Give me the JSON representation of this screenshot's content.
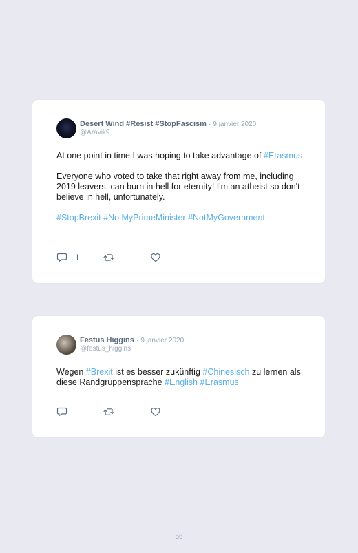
{
  "tweets": [
    {
      "author": "Desert Wind #Resist #StopFascism",
      "date": "9 janvier 2020",
      "handle": "@Aravik9",
      "p1": [
        "At one point in time I was hoping to take advantage of ",
        "#Erasmus"
      ],
      "p2": "Everyone who voted to take that right away from me, including 2019 leavers, can burn in hell for eternity! I'm an atheist so don't believe in hell, unfortunately.",
      "p3": [
        "#StopBrexit",
        "#NotMyPrimeMinister",
        "#NotMyGovernment"
      ],
      "reply_count": "1"
    },
    {
      "author": "Festus Higgins",
      "date": "9 janvier 2020",
      "handle": "@festus_higgins",
      "p1": [
        "Wegen ",
        "#Brexit",
        " ist es besser zukünftig ",
        "#Chinesisch",
        " zu lernen als diese Randgruppensprache ",
        "#English",
        " ",
        "#Erasmus"
      ]
    }
  ],
  "separator": "·",
  "icons": {
    "reply": "reply-icon",
    "retweet": "retweet-icon",
    "like": "heart-icon"
  },
  "colors": {
    "hashtag": "#5bb0e8",
    "name": "#5b6b7e",
    "meta": "#9aa6b4",
    "background": "#e9eaf1"
  },
  "page_number": "56"
}
